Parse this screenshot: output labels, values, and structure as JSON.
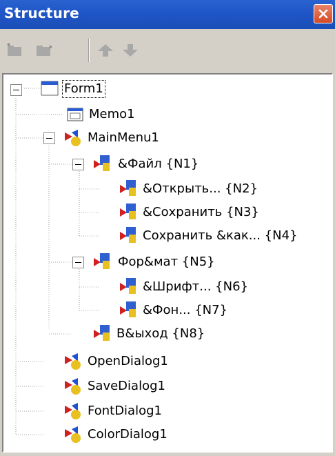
{
  "window": {
    "title": "Structure"
  },
  "toolbar": {
    "buttons": [
      {
        "icon": "add-item-icon"
      },
      {
        "icon": "add-subitem-icon"
      },
      {
        "icon": "move-up-icon"
      },
      {
        "icon": "move-down-icon"
      }
    ]
  },
  "tree": {
    "form1": "Form1",
    "memo1": "Memo1",
    "mainmenu1": "MainMenu1",
    "file": "&Файл {N1}",
    "open": "&Открыть... {N2}",
    "save": "&Сохранить {N3}",
    "saveas": "Сохранить &как... {N4}",
    "format": "Фор&мат {N5}",
    "font": "&Шрифт... {N6}",
    "background": "&Фон... {N7}",
    "exit": "В&ыход {N8}",
    "opendialog1": "OpenDialog1",
    "savedialog1": "SaveDialog1",
    "fontdialog1": "FontDialog1",
    "colordialog1": "ColorDialog1"
  }
}
